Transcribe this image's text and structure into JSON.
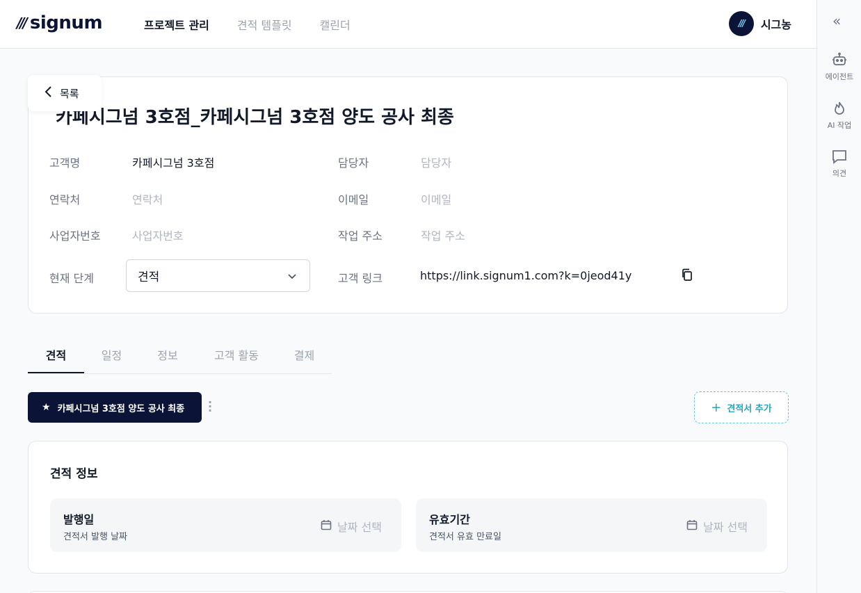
{
  "brand": {
    "logo_text": "signum"
  },
  "nav": {
    "items": [
      {
        "label": "프로젝트 관리",
        "active": true
      },
      {
        "label": "견적 템플릿",
        "active": false
      },
      {
        "label": "캘린더",
        "active": false
      }
    ]
  },
  "user": {
    "name": "시그농"
  },
  "rail": {
    "collapse_icon": "chevrons-left-icon",
    "items": [
      {
        "label": "에이전트",
        "icon": "robot-icon"
      },
      {
        "label": "AI 작업",
        "icon": "flame-icon"
      },
      {
        "label": "의견",
        "icon": "comment-icon"
      }
    ]
  },
  "back": {
    "label": "목록"
  },
  "project": {
    "title": "카페시그넘 3호점_카페시그넘 3호점 양도 공사 최종",
    "fields": {
      "customer_label": "고객명",
      "customer_value": "카페시그넘 3호점",
      "manager_label": "담당자",
      "manager_placeholder": "담당자",
      "contact_label": "연락처",
      "contact_placeholder": "연락처",
      "email_label": "이메일",
      "email_placeholder": "이메일",
      "bizno_label": "사업자번호",
      "bizno_placeholder": "사업자번호",
      "address_label": "작업 주소",
      "address_placeholder": "작업 주소",
      "stage_label": "현재 단계",
      "stage_value": "견적",
      "link_label": "고객 링크",
      "link_value": "https://link.signum1.com?k=0jeod41y"
    }
  },
  "tabs": [
    {
      "label": "견적",
      "active": true
    },
    {
      "label": "일정",
      "active": false
    },
    {
      "label": "정보",
      "active": false
    },
    {
      "label": "고객 활동",
      "active": false
    },
    {
      "label": "결제",
      "active": false
    }
  ],
  "quote_chip": {
    "label": "카페시그넘 3호점 양도 공사 최종"
  },
  "add_quote": {
    "label": "견적서 추가"
  },
  "quote_info": {
    "title": "견적 정보",
    "issue": {
      "title": "발행일",
      "sub": "견적서 발행 날짜",
      "picker": "날짜 선택"
    },
    "valid": {
      "title": "유효기간",
      "sub": "견적서 유효 만료일",
      "picker": "날짜 선택"
    }
  },
  "colors": {
    "brand_navy": "#0b1437",
    "accent_teal": "#2aa3b8"
  }
}
